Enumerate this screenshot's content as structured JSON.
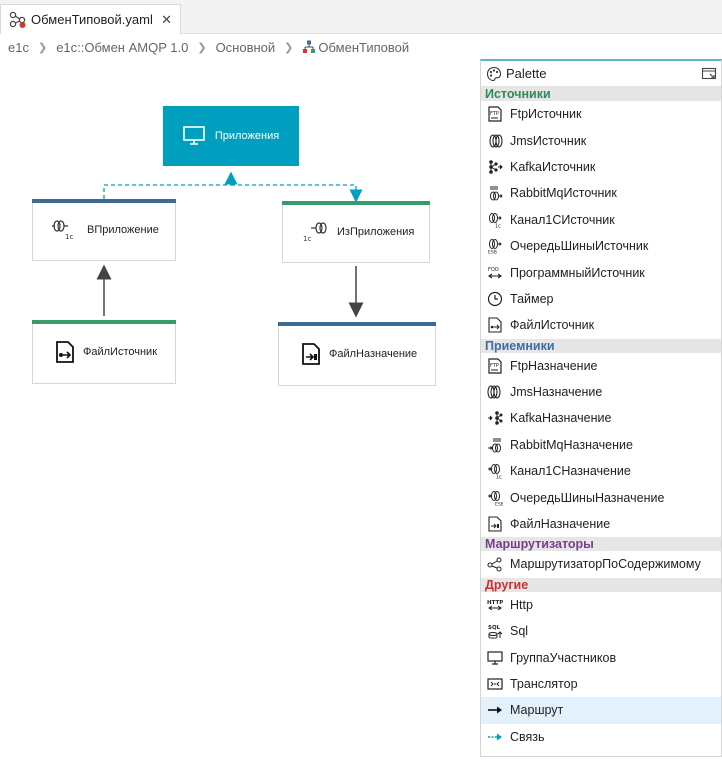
{
  "tab": {
    "title": "ОбменТиповой.yaml",
    "close": "✕"
  },
  "breadcrumb": [
    "e1c",
    "e1c::Обмен AMQP 1.0",
    "Основной",
    "ОбменТиповой"
  ],
  "nodes": {
    "apps": "Приложения",
    "in_app": "ВПриложение",
    "out_app": "ИзПриложения",
    "file_src": "ФайлИсточник",
    "file_dst": "ФайлНазначение"
  },
  "palette": {
    "title": "Palette",
    "categories": [
      {
        "name": "Источники",
        "color": "#2e8b57",
        "items": [
          "FtpИсточник",
          "JmsИсточник",
          "KafkaИсточник",
          "RabbitMqИсточник",
          "Канал1СИсточник",
          "ОчередьШиныИсточник",
          "ПрограммныйИсточник",
          "Таймер",
          "ФайлИсточник"
        ]
      },
      {
        "name": "Приемники",
        "color": "#3a6ea5",
        "items": [
          "FtpНазначение",
          "JmsНазначение",
          "KafkaНазначение",
          "RabbitMqНазначение",
          "Канал1СНазначение",
          "ОчередьШиныНазначение",
          "ФайлНазначение"
        ]
      },
      {
        "name": "Маршрутизаторы",
        "color": "#7a3d8f",
        "items": [
          "МаршрутизаторПоСодержимому"
        ]
      },
      {
        "name": "Другие",
        "color": "#c83232",
        "items": [
          "Http",
          "Sql",
          "ГруппаУчастников",
          "Транслятор",
          "Маршрут",
          "Связь"
        ]
      }
    ]
  },
  "colors": {
    "accent": "#009fbf",
    "source_bar": "#3a9a6a",
    "dest_bar": "#3f6a94",
    "selected_bg": "#e3f1fc"
  }
}
